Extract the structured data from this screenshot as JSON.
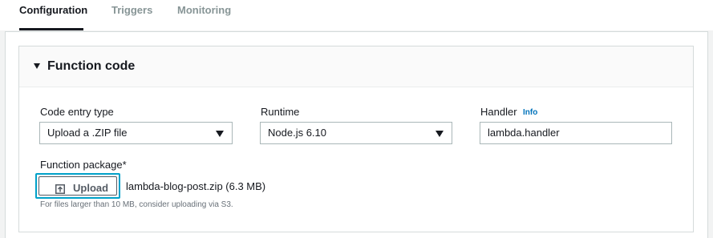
{
  "tabs": [
    {
      "label": "Configuration",
      "active": true
    },
    {
      "label": "Triggers",
      "active": false
    },
    {
      "label": "Monitoring",
      "active": false
    }
  ],
  "section": {
    "title": "Function code",
    "expanded": true
  },
  "fields": {
    "code_entry_type": {
      "label": "Code entry type",
      "value": "Upload a .ZIP file"
    },
    "runtime": {
      "label": "Runtime",
      "value": "Node.js 6.10"
    },
    "handler": {
      "label": "Handler",
      "info": "Info",
      "value": "lambda.handler"
    }
  },
  "function_package": {
    "label": "Function package*",
    "upload_label": "Upload",
    "file_name": "lambda-blog-post.zip (6.3 MB)",
    "hint": "For files larger than 10 MB, consider uploading via S3."
  },
  "icons": [
    "caret-down-icon",
    "dropdown-arrow-icon",
    "upload-icon"
  ],
  "colors": {
    "accent": "#0073bb",
    "focus_ring": "#00a1c9",
    "border": "#aab7b8",
    "background": "#f2f3f3"
  }
}
